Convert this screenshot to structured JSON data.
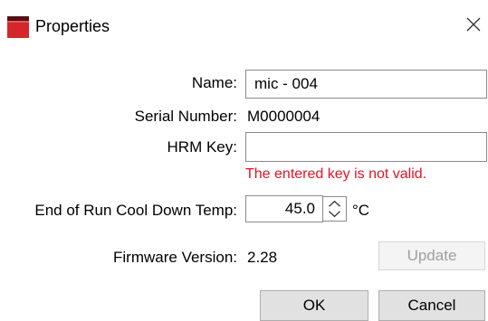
{
  "window": {
    "title": "Properties",
    "icon": "app-red-square-icon",
    "close_icon": "close-icon"
  },
  "form": {
    "name": {
      "label": "Name:",
      "value": "mic - 004"
    },
    "serial": {
      "label": "Serial Number:",
      "value": "M0000004"
    },
    "hrm_key": {
      "label": "HRM Key:",
      "value": "",
      "error": "The entered key is not valid."
    },
    "cooldown": {
      "label": "End of Run Cool Down Temp:",
      "value": "45.0",
      "unit": "°C"
    },
    "firmware": {
      "label": "Firmware Version:",
      "value": "2.28"
    }
  },
  "buttons": {
    "update": "Update",
    "ok": "OK",
    "cancel": "Cancel"
  },
  "colors": {
    "error": "#e81123",
    "icon_red": "#d4262b",
    "icon_dark": "#5a0f12"
  }
}
